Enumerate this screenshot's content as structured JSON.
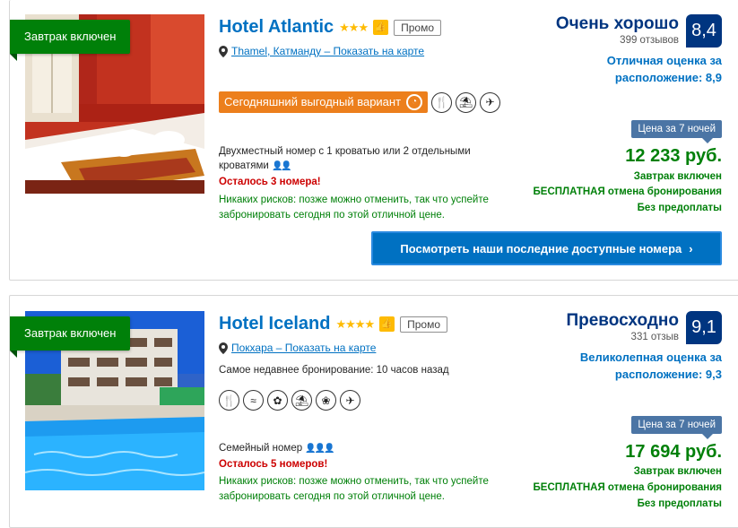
{
  "hotels": [
    {
      "ribbon": "Завтрак включен",
      "name": "Hotel Atlantic",
      "stars": "★★★",
      "thumb_icon": "thumbs-up-icon",
      "promo": "Промо",
      "location": "Thamel, Катманду – Показать на карте",
      "deal_badge": "Сегодняшний выгодный вариант",
      "facilities": [
        "restaurant-icon",
        "beach-umbrella-icon",
        "shuttle-icon"
      ],
      "room_desc": "Двухместный номер с 1 кроватью или 2 отдельными кроватями",
      "rooms_left": "Осталось 3 номера!",
      "no_risk": "Никаких рисков: позже можно отменить, так что успейте забронировать сегодня по этой отличной цене.",
      "score_word": "Очень хорошо",
      "reviews": "399 отзывов",
      "score": "8,4",
      "location_score": "Отличная оценка за расположение: 8,9",
      "price_label": "Цена за 7 ночей",
      "price": "12 233 руб.",
      "perk1": "Завтрак включен",
      "perk2": "БЕСПЛАТНАЯ отмена бронирования",
      "perk3": "Без предоплаты",
      "cta": "Посмотреть наши последние доступные номера",
      "cta_icon": "chevron-right-icon"
    },
    {
      "ribbon": "Завтрак включен",
      "name": "Hotel Iceland",
      "stars": "★★★★",
      "thumb_icon": "thumbs-up-icon",
      "promo": "Промо",
      "location": "Покхара – Показать на карте",
      "latest_booking": "Самое недавнее бронирование: 10 часов назад",
      "facilities": [
        "restaurant-icon",
        "pool-icon",
        "spa-icon",
        "beach-umbrella-icon",
        "garden-icon",
        "shuttle-icon"
      ],
      "room_desc": "Семейный номер",
      "rooms_left": "Осталось 5 номеров!",
      "no_risk": "Никаких рисков: позже можно отменить, так что успейте забронировать сегодня по этой отличной цене.",
      "score_word": "Превосходно",
      "reviews": "331 отзыв",
      "score": "9,1",
      "location_score": "Великолепная оценка за расположение: 9,3",
      "price_label": "Цена за 7 ночей",
      "price": "17 694 руб.",
      "perk1": "Завтрак включен",
      "perk2": "БЕСПЛАТНАЯ отмена бронирования",
      "perk3": "Без предоплаты"
    }
  ],
  "colors": {
    "brand_blue": "#0071c2",
    "dark_blue": "#003580",
    "green": "#008009",
    "deal_orange": "#ec7f1c",
    "star_yellow": "#febb02",
    "price_tag": "#4b75a5",
    "red": "#cc0000"
  }
}
